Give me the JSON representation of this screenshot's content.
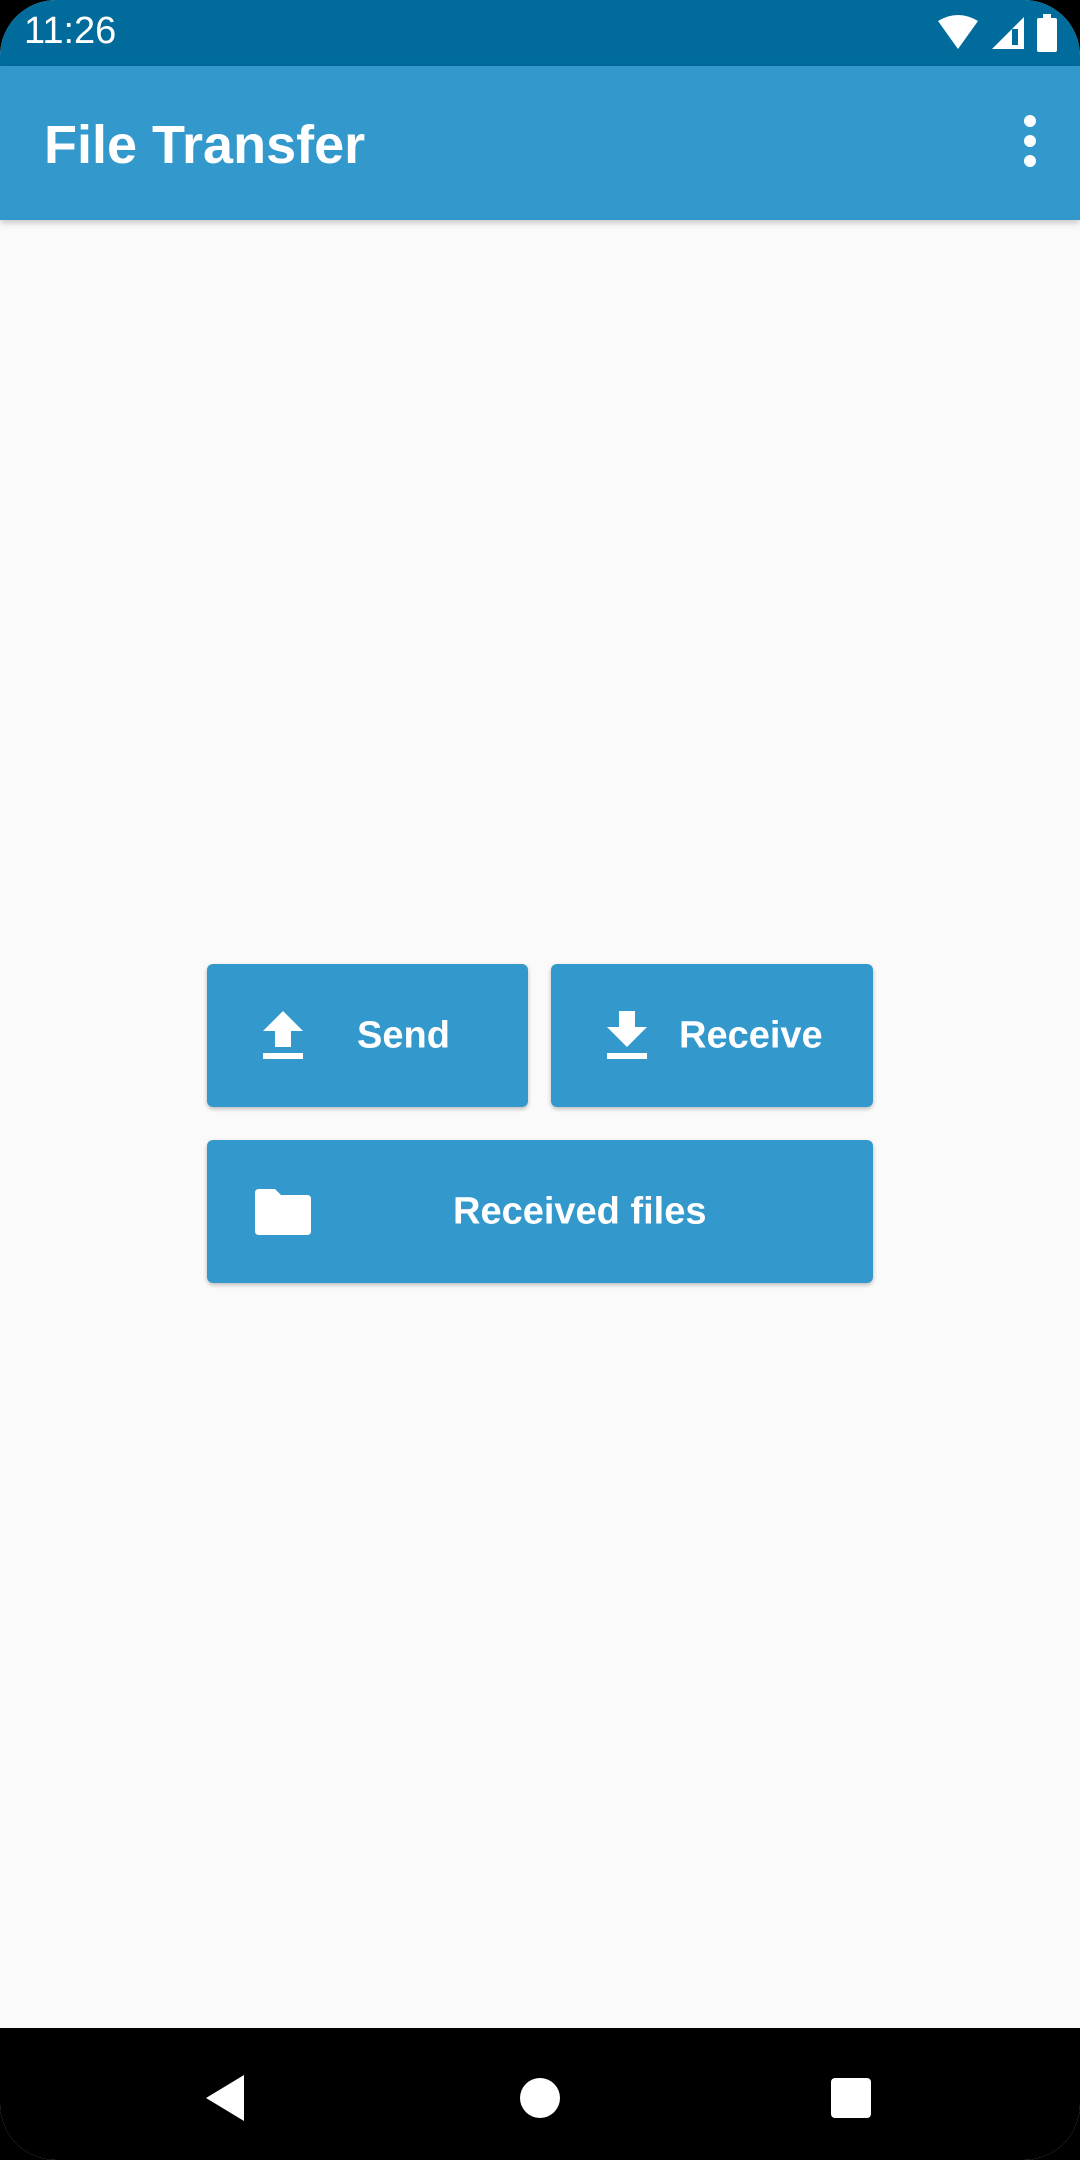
{
  "status_bar": {
    "time": "11:26",
    "icons": [
      "wifi-icon",
      "cell-signal-icon",
      "battery-icon"
    ]
  },
  "app_bar": {
    "title": "File Transfer",
    "overflow_icon": "more-vert-icon"
  },
  "main": {
    "buttons": [
      {
        "label": "Send",
        "icon": "upload-icon"
      },
      {
        "label": "Receive",
        "icon": "download-icon"
      },
      {
        "label": "Received files",
        "icon": "folder-icon"
      }
    ]
  },
  "nav_bar": {
    "buttons": [
      "back",
      "home",
      "recents"
    ]
  },
  "colors": {
    "status_bar": "#016c9c",
    "primary": "#3399cc",
    "background": "#fafafa"
  }
}
